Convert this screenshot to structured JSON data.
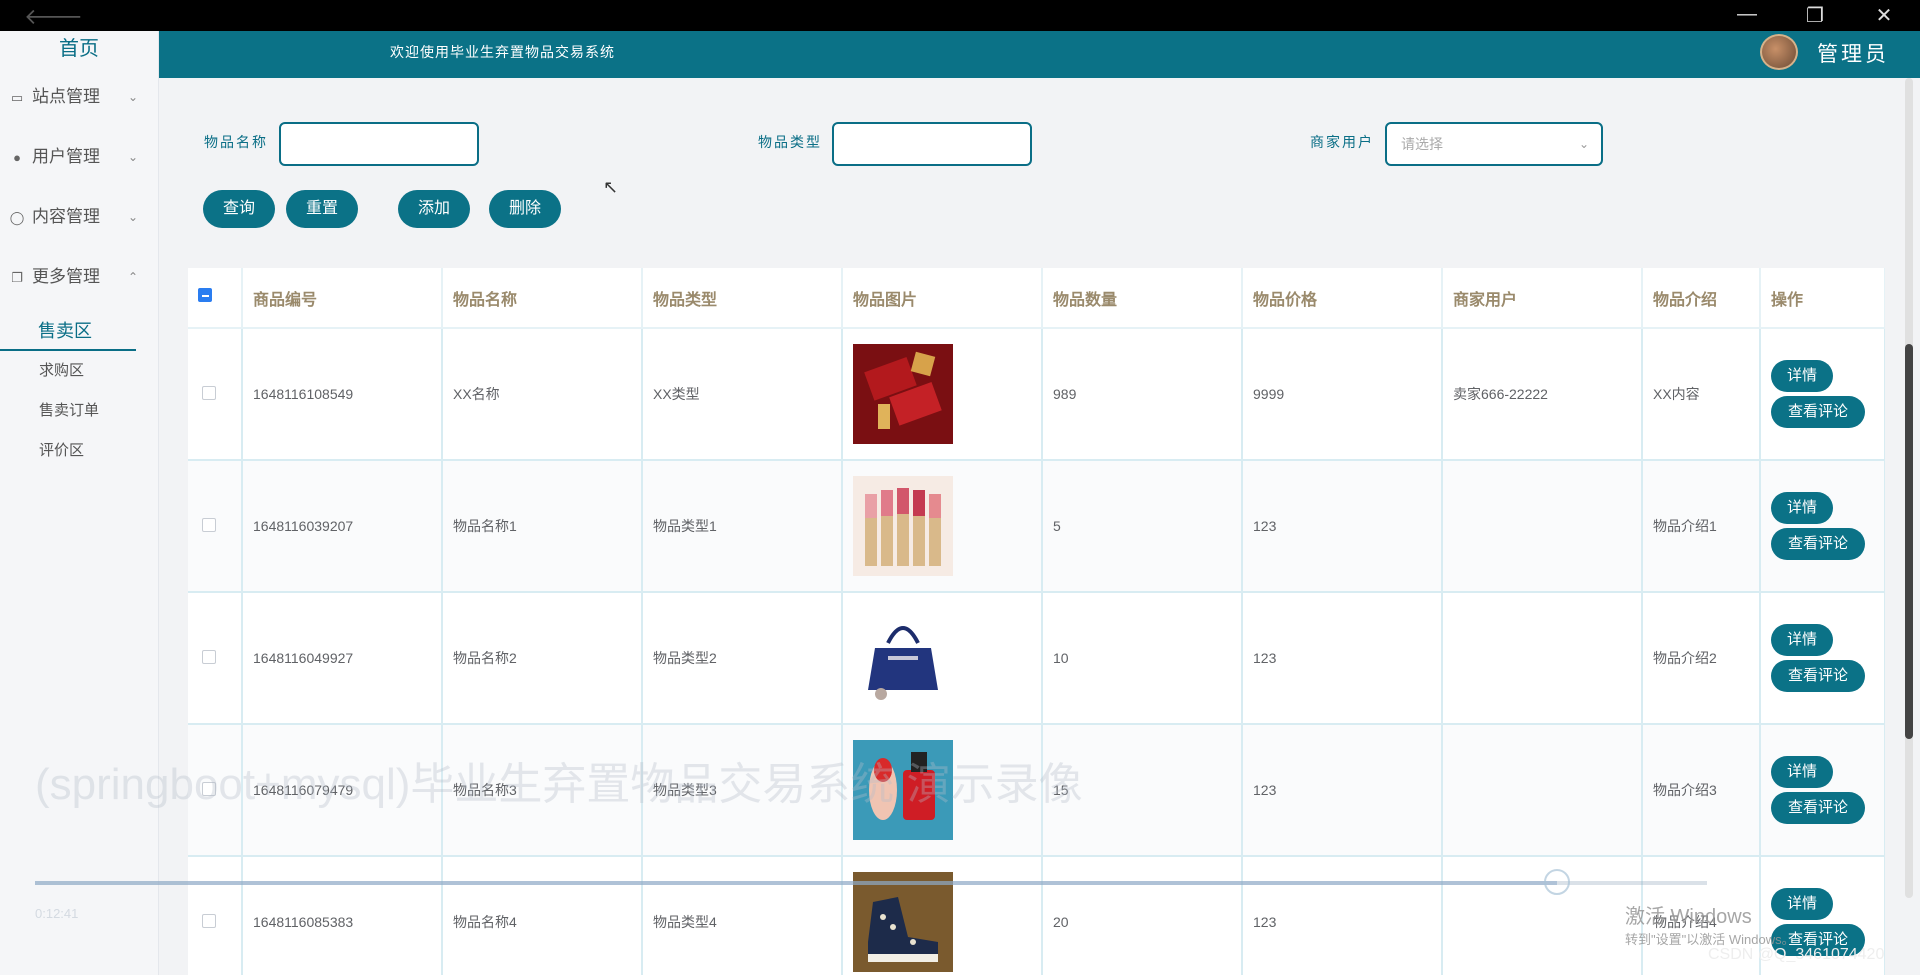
{
  "window": {
    "back_glyph": "🡐",
    "minimize": "—",
    "restore": "❐",
    "close": "✕"
  },
  "sidebar": {
    "home": "首页",
    "menus": [
      {
        "label": "站点管理",
        "icon": "monitor-icon",
        "glyph": "▭",
        "chevron": "⌄"
      },
      {
        "label": "用户管理",
        "icon": "user-icon",
        "glyph": "●",
        "chevron": "⌄"
      },
      {
        "label": "内容管理",
        "icon": "chat-icon",
        "glyph": "◯",
        "chevron": "⌄"
      },
      {
        "label": "更多管理",
        "icon": "copy-icon",
        "glyph": "❐",
        "chevron": "⌃"
      }
    ],
    "submenu": [
      "售卖区",
      "求购区",
      "售卖订单",
      "评价区"
    ]
  },
  "header": {
    "welcome": "欢迎使用毕业生弃置物品交易系统",
    "admin": "管理员"
  },
  "search": {
    "name_label": "物品名称",
    "name_value": "",
    "type_label": "物品类型",
    "type_value": "",
    "seller_label": "商家用户",
    "seller_placeholder": "请选择",
    "select_arrow": "⌄"
  },
  "buttons": {
    "query": "查询",
    "reset": "重置",
    "add": "添加",
    "delete": "删除"
  },
  "table": {
    "columns": [
      "商品编号",
      "物品名称",
      "物品类型",
      "物品图片",
      "物品数量",
      "物品价格",
      "商家用户",
      "物品介绍",
      "操作"
    ],
    "rows": [
      {
        "id": "1648116108549",
        "name": "XX名称",
        "type": "XX类型",
        "image": "lipstick-box-image",
        "qty": "989",
        "price": "9999",
        "seller": "卖家666-22222",
        "intro": "XX内容"
      },
      {
        "id": "1648116039207",
        "name": "物品名称1",
        "type": "物品类型1",
        "image": "lipsticks-image",
        "qty": "5",
        "price": "123",
        "seller": "",
        "intro": "物品介绍1"
      },
      {
        "id": "1648116049927",
        "name": "物品名称2",
        "type": "物品类型2",
        "image": "handbag-image",
        "qty": "10",
        "price": "123",
        "seller": "",
        "intro": "物品介绍2"
      },
      {
        "id": "1648116079479",
        "name": "物品名称3",
        "type": "物品类型3",
        "image": "nail-polish-image",
        "qty": "15",
        "price": "123",
        "seller": "",
        "intro": "物品介绍3"
      },
      {
        "id": "1648116085383",
        "name": "物品名称4",
        "type": "物品类型4",
        "image": "sneakers-image",
        "qty": "20",
        "price": "123",
        "seller": "",
        "intro": "物品介绍4"
      }
    ],
    "detail_label": "详情",
    "review_label": "查看评论",
    "overflow_glyph": "."
  },
  "overlay": {
    "watermark": "(springboot+mysql)毕业生弃置物品交易系统 演示录像",
    "timecode": "0:12:41",
    "progress": 0.91,
    "activate_title": "激活 Windows",
    "activate_sub": "转到\"设置\"以激活 Windows。",
    "csdn": "CSDN @Q_3461074420"
  },
  "colors": {
    "primary": "#0b7287",
    "header_text": "#9a8a6c",
    "sidebar_active": "#0a6e86"
  }
}
